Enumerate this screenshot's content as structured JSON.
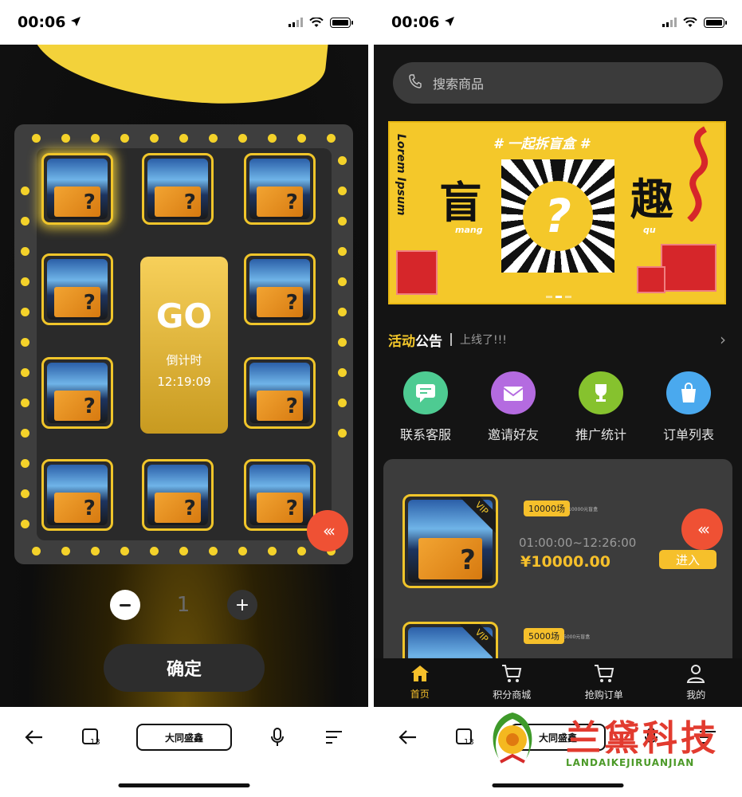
{
  "left_phone": {
    "status": {
      "time": "00:06"
    },
    "game": {
      "go_label": "GO",
      "countdown_label": "倒计时",
      "countdown_value": "12:19:09",
      "box_glyph": "?"
    },
    "stepper": {
      "minus": "−",
      "value": "1",
      "plus": "+"
    },
    "confirm_label": "确定",
    "browser": {
      "url": "大同盛鑫"
    }
  },
  "right_phone": {
    "status": {
      "time": "00:06"
    },
    "search": {
      "placeholder": "搜索商品"
    },
    "banner": {
      "title": "# 一起拆盲盒 #",
      "vertical": "Lorem Ipsum",
      "left_char": "盲",
      "right_char": "趣",
      "left_pinyin": "mang",
      "right_pinyin": "qu",
      "center_glyph": "?"
    },
    "notice": {
      "label_a": "活动",
      "label_b": "公告",
      "text": "上线了!!!"
    },
    "quick_actions": [
      {
        "label": "联系客服",
        "icon": "chat-icon",
        "color": "#4ecb92"
      },
      {
        "label": "邀请好友",
        "icon": "mail-icon",
        "color": "#b46be0"
      },
      {
        "label": "推广统计",
        "icon": "trophy-icon",
        "color": "#86c22e"
      },
      {
        "label": "订单列表",
        "icon": "bag-icon",
        "color": "#4aa9ee"
      }
    ],
    "products": [
      {
        "badge": "10000场",
        "badge_sub": "10000元盲盒",
        "vip": "VIP",
        "time": "01:00:00~12:26:00",
        "price": "¥10000.00",
        "enter": "进入"
      },
      {
        "badge": "5000场",
        "badge_sub": "5000元盲盒",
        "vip": "VIP"
      }
    ],
    "tabs": [
      {
        "label": "首页",
        "icon": "home-icon",
        "active": true
      },
      {
        "label": "积分商城",
        "icon": "cart-icon",
        "active": false
      },
      {
        "label": "抢购订单",
        "icon": "cart-icon",
        "active": false
      },
      {
        "label": "我的",
        "icon": "user-icon",
        "active": false
      }
    ],
    "browser": {
      "url": "大同盛鑫"
    }
  },
  "watermark": {
    "text": "兰黛科技",
    "sub": "LANDAIKEJIRUANJIAN"
  },
  "colors": {
    "accent": "#f6c02b",
    "red": "#ef5134",
    "panel": "#3c3c3c"
  }
}
